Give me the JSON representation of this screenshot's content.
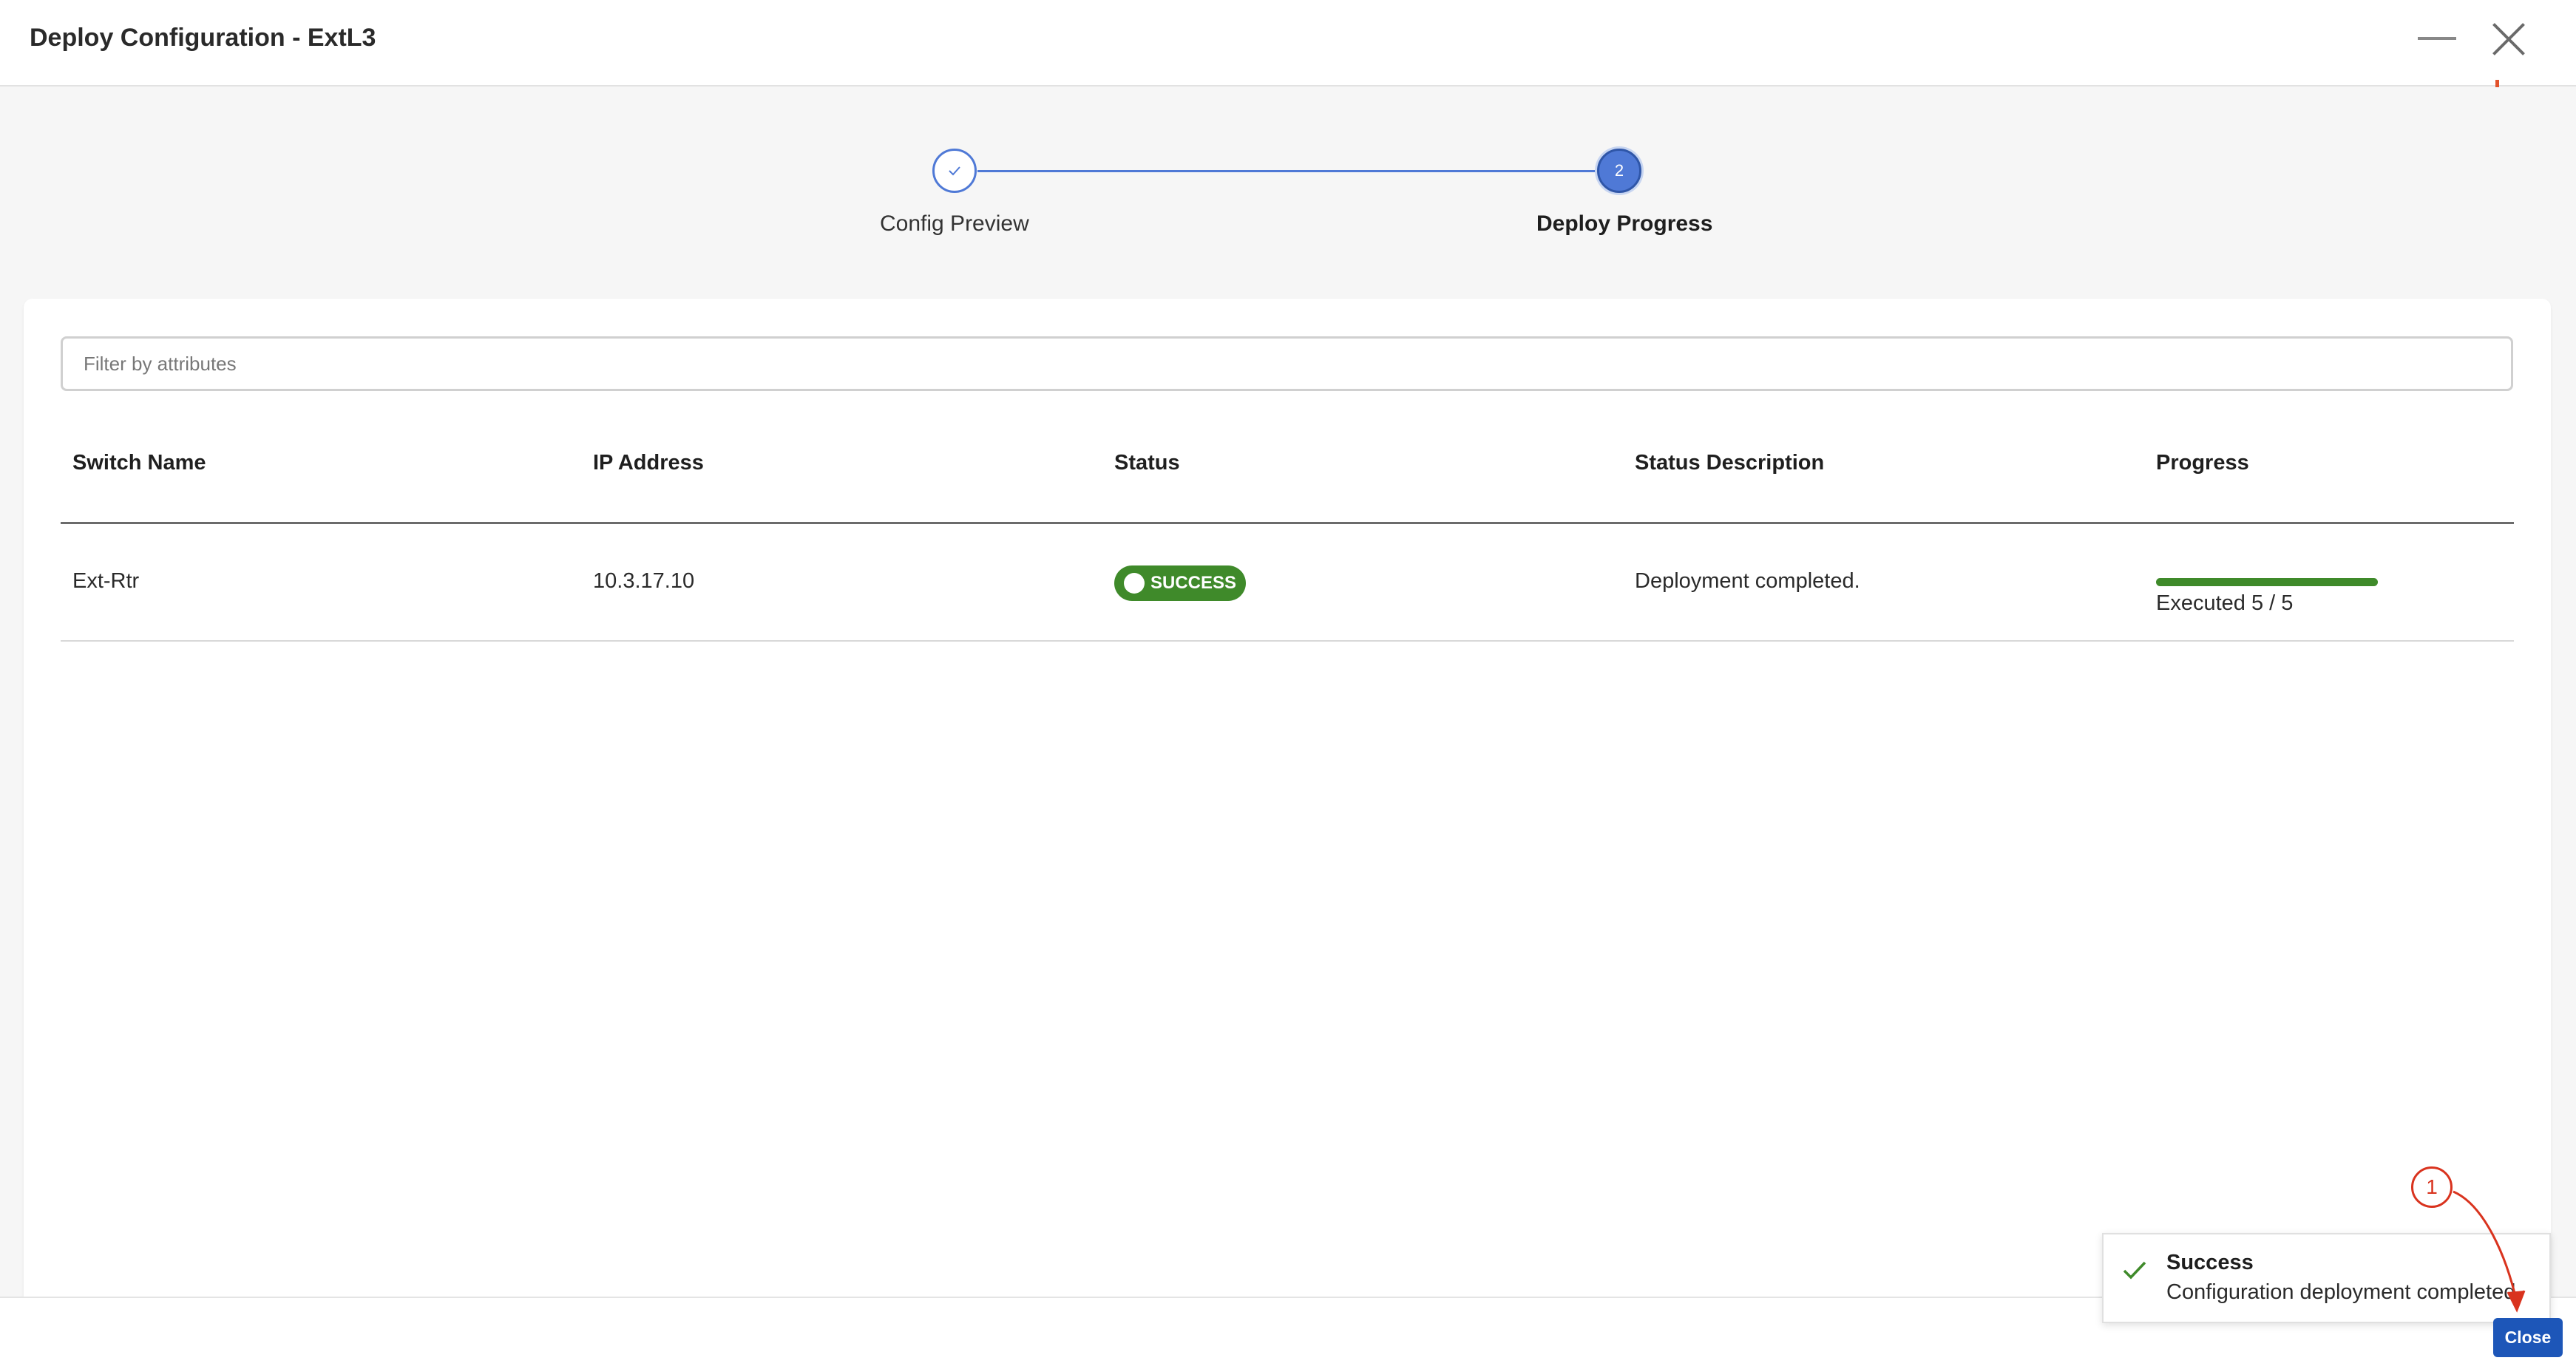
{
  "window": {
    "title": "Deploy Configuration - ExtL3"
  },
  "stepper": {
    "steps": [
      {
        "number": "1",
        "label": "Config Preview",
        "state": "complete"
      },
      {
        "number": "2",
        "label": "Deploy Progress",
        "state": "active"
      }
    ]
  },
  "filter": {
    "placeholder": "Filter by attributes",
    "value": ""
  },
  "table": {
    "columns": [
      "Switch Name",
      "IP Address",
      "Status",
      "Status Description",
      "Progress"
    ],
    "rows": [
      {
        "switch_name": "Ext-Rtr",
        "ip_address": "10.3.17.10",
        "status": "SUCCESS",
        "status_description": "Deployment completed.",
        "progress_text": "Executed 5 / 5",
        "progress_fraction": 1.0
      }
    ]
  },
  "toast": {
    "title": "Success",
    "message": "Configuration deployment completed."
  },
  "footer": {
    "close_label": "Close"
  },
  "annotation": {
    "callout_number": "1"
  },
  "colors": {
    "accent_blue": "#4f79d6",
    "success_green": "#3f8a2a",
    "primary_button": "#1d56b8",
    "annotation_red": "#d9331e"
  },
  "icons": {
    "step_complete": "check-icon",
    "toast": "check-icon",
    "window_close": "close-icon",
    "window_minimize": "minimize-icon"
  }
}
